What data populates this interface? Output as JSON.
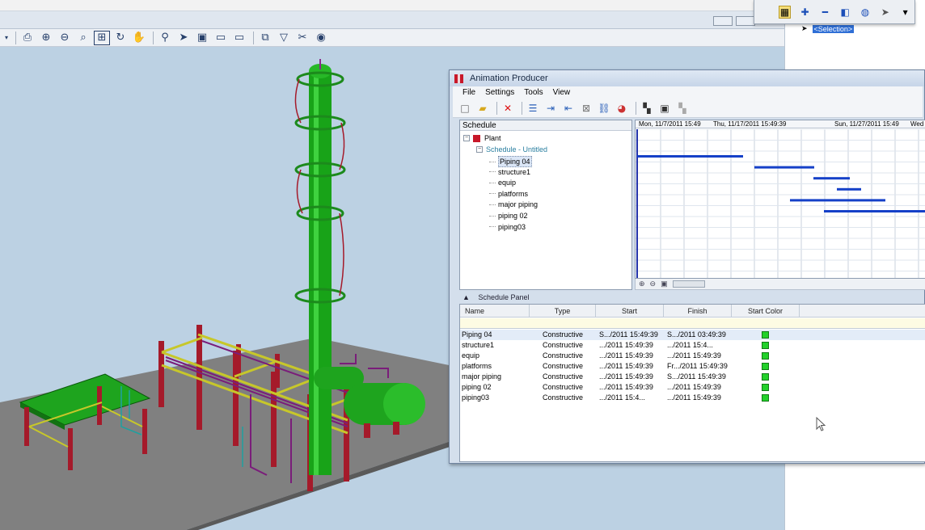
{
  "app": {
    "toolbar_icons": [
      "print-icon",
      "zoom-in-icon",
      "zoom-out-icon",
      "zoom-window-icon",
      "fit-view-icon",
      "rotate-view-icon",
      "pan-hand-icon",
      "walk-icon",
      "select-icon",
      "view-1-icon",
      "view-2-icon",
      "view-3-icon",
      "clip-icon",
      "filter-icon",
      "tools-icon",
      "render-icon"
    ]
  },
  "right_panel": {
    "selection_label": "<Selection>"
  },
  "animation_producer": {
    "title": "Animation Producer",
    "menu": [
      "File",
      "Settings",
      "Tools",
      "View"
    ],
    "schedule_tree": {
      "header": "Schedule",
      "root": "Plant",
      "schedule": "Schedule - Untitled",
      "items": [
        "Piping 04",
        "structure1",
        "equip",
        "platforms",
        "major piping",
        "piping 02",
        "piping03"
      ],
      "selected": "Piping 04"
    },
    "gantt": {
      "header_left": "Mon, 11/7/2011 15:49",
      "header_mid": "Thu, 11/17/2011 15:49:39",
      "header_right": "Sun, 11/27/2011 15:49",
      "header_right_cut": "Wed"
    },
    "panel_caption": "Schedule Panel",
    "grid": {
      "columns": [
        "Name",
        "Type",
        "Start",
        "Finish",
        "Start Color"
      ],
      "rows": [
        {
          "name": "Piping 04",
          "type": "Constructive",
          "start": "S.../2011 15:49:39",
          "finish": "S.../2011 03:49:39",
          "color": "#22d12a"
        },
        {
          "name": "structure1",
          "type": "Constructive",
          "start": ".../2011 15:49:39",
          "finish": ".../2011 15:4...",
          "color": "#22d12a"
        },
        {
          "name": "equip",
          "type": "Constructive",
          "start": ".../2011 15:49:39",
          "finish": ".../2011 15:49:39",
          "color": "#22d12a"
        },
        {
          "name": "platforms",
          "type": "Constructive",
          "start": ".../2011 15:49:39",
          "finish": "Fr.../2011 15:49:39",
          "color": "#22d12a"
        },
        {
          "name": "major piping",
          "type": "Constructive",
          "start": ".../2011 15:49:39",
          "finish": "S.../2011 15:49:39",
          "color": "#22d12a"
        },
        {
          "name": "piping 02",
          "type": "Constructive",
          "start": ".../2011 15:49:39",
          "finish": ".../2011 15:49:39",
          "color": "#22d12a"
        },
        {
          "name": "piping03",
          "type": "Constructive",
          "start": ".../2011 15:4...",
          "finish": ".../2011 15:49:39",
          "color": "#22d12a"
        }
      ]
    }
  }
}
